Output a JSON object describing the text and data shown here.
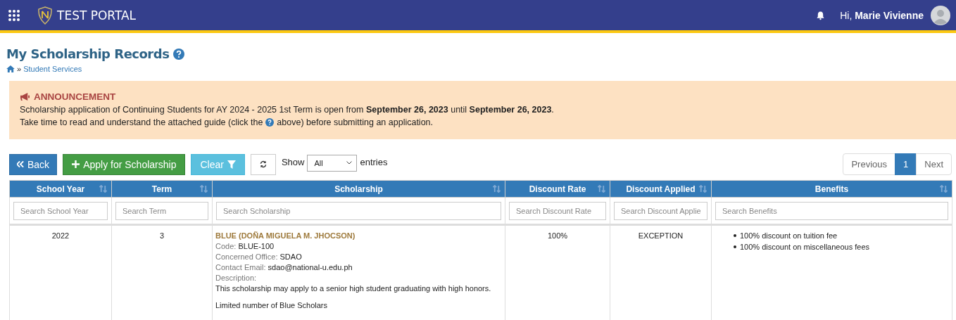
{
  "header": {
    "title": "TEST PORTAL",
    "greeting": "Hi,",
    "user_name": "Marie Vivienne"
  },
  "page": {
    "title": "My Scholarship Records",
    "breadcrumb_separator": "»",
    "breadcrumb": [
      "Student Services"
    ]
  },
  "announcement": {
    "title": "ANNOUNCEMENT",
    "lines": [
      "Scholarship application of Continuing Students for AY 2024 - 2025 1st Term is open from **September 26, 2023** until **September 26, 2023**.",
      "Take time to read and understand the attached guide (click the",
      "above) before submitting an application."
    ]
  },
  "toolbar": {
    "back": "Back",
    "apply": "Apply for Scholarship",
    "clear": "Clear",
    "show_label": "Show",
    "show_value": "All",
    "entries_label": "entries"
  },
  "pagination": [
    {
      "label": "Previous",
      "selected": false
    },
    {
      "label": "1",
      "selected": true
    },
    {
      "label": "Next",
      "selected": false
    }
  ],
  "table": {
    "columns": [
      {
        "label": "School Year",
        "placeholder": "Search School Year"
      },
      {
        "label": "Term",
        "placeholder": "Search Term"
      },
      {
        "label": "Scholarship",
        "placeholder": "Search Scholarship"
      },
      {
        "label": "Discount Rate",
        "placeholder": "Search Discount Rate"
      },
      {
        "label": "Discount Applied",
        "placeholder": "Search Discount Applie"
      },
      {
        "label": "Benefits",
        "placeholder": "Search Benefits"
      }
    ],
    "rows": [
      {
        "school_year": "2022",
        "term": "3",
        "scholarship": {
          "name": "BLUE (DOÑA MIGUELA M. JHOCSON)",
          "fields": [
            {
              "label": "Code:",
              "value": "BLUE-100"
            },
            {
              "label": "Concerned Office:",
              "value": "SDAO"
            },
            {
              "label": "Contact Email:",
              "value": "sdao@national-u.edu.ph"
            }
          ],
          "description_label": "Description:",
          "description": [
            "This scholarship may apply to a senior high student graduating with high honors.",
            "Limited number of Blue Scholars"
          ]
        },
        "discount_rate": "100%",
        "discount_applied": "EXCEPTION",
        "benefits": [
          "100% discount on tuition fee",
          "100% discount on miscellaneous fees"
        ]
      }
    ]
  }
}
